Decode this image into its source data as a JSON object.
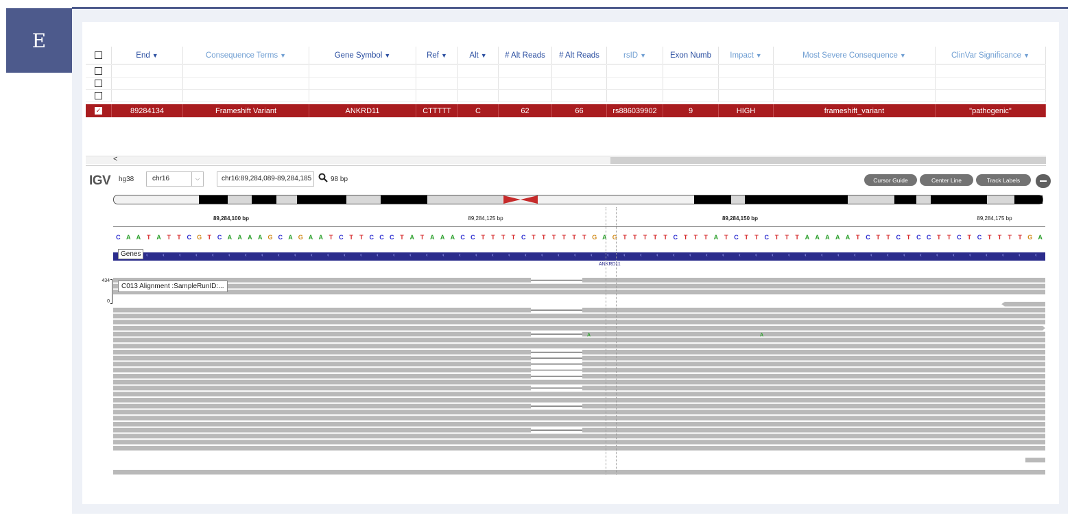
{
  "panel_label": "E",
  "table": {
    "columns": [
      {
        "label": "End",
        "filter": true,
        "style": "active",
        "w": 104
      },
      {
        "label": "Consequence Terms",
        "filter": true,
        "style": "muted",
        "w": 184
      },
      {
        "label": "Gene Symbol",
        "filter": true,
        "style": "active",
        "w": 156
      },
      {
        "label": "Ref",
        "filter": true,
        "style": "active",
        "w": 61
      },
      {
        "label": "Alt",
        "filter": true,
        "style": "active",
        "w": 59
      },
      {
        "label": "# Alt Reads",
        "filter": false,
        "style": "active",
        "w": 78
      },
      {
        "label": "# Alt Reads",
        "filter": false,
        "style": "active",
        "w": 80
      },
      {
        "label": "rsID",
        "filter": true,
        "style": "muted",
        "w": 82
      },
      {
        "label": "Exon Numb",
        "filter": false,
        "style": "active",
        "w": 81
      },
      {
        "label": "Impact",
        "filter": true,
        "style": "muted",
        "w": 80
      },
      {
        "label": "Most Severe Consequence",
        "filter": true,
        "style": "muted",
        "w": 236
      },
      {
        "label": "ClinVar Significance",
        "filter": true,
        "style": "muted",
        "w": 161
      }
    ],
    "empty_rows": 3,
    "selected_row": [
      "89284134",
      "Frameshift Variant",
      "ANKRD11",
      "CTTTTT",
      "C",
      "62",
      "66",
      "rs886039902",
      "9",
      "HIGH",
      "frameshift_variant",
      "\"pathogenic\""
    ],
    "scroll_left_glyph": "<"
  },
  "igv": {
    "logo": "IGV",
    "genome": "hg38",
    "chromosome": "chr16",
    "locus": "chr16:89,284,089-89,284,185",
    "width_label": "98 bp",
    "buttons": [
      "Cursor Guide",
      "Center Line",
      "Track Labels"
    ],
    "ruler_ticks": [
      "89,284,100 bp",
      "89,284,125 bp",
      "89,284,150 bp",
      "89,284,175 bp"
    ],
    "sequence": "CAATATTCGTCAAAAGCAGAATCTTCCCTATAAACCTTTTCTTTTTTGAGTTTTTCTTTATCTTCTTTAAAAATCTTCTCCTTCTCTTTTGA",
    "genes_track_label": "Genes",
    "gene_name": "ANKRD11",
    "alignment_track_label": "C013 Alignment :SampleRunID:...",
    "coverage_max": "434",
    "coverage_min": "0",
    "deletion_rows": [
      0,
      3,
      4,
      5,
      9,
      12,
      13,
      14,
      15,
      16,
      18,
      21,
      25
    ],
    "mismatch_base": "A",
    "colors": {
      "A": "#2ca02c",
      "C": "#2b2ccf",
      "G": "#d18a18",
      "T": "#d62728",
      "read": "#b9b9b9",
      "selected": "#a91c1f",
      "genes": "#2b2c8c"
    }
  }
}
